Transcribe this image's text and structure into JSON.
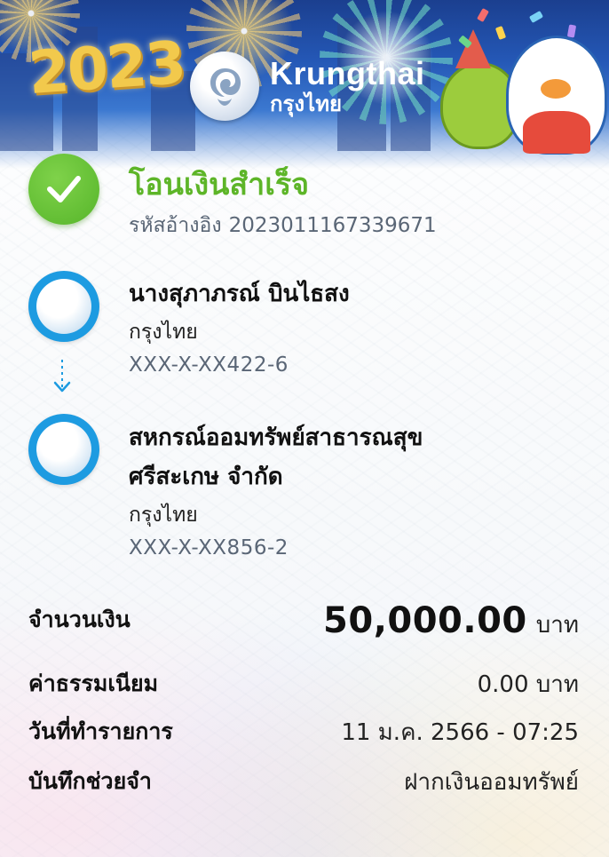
{
  "banner": {
    "year": "2023",
    "logo_en": "Krungthai",
    "logo_th": "กรุงไทย"
  },
  "status": {
    "title": "โอนเงินสำเร็จ",
    "ref_label": "รหัสอ้างอิง",
    "ref_value": "2023011167339671"
  },
  "sender": {
    "name": "นางสุภาภรณ์ บินไธสง",
    "bank": "กรุงไทย",
    "account": "XXX-X-XX422-6"
  },
  "receiver": {
    "name_line1": "สหกรณ์ออมทรัพย์สาธารณสุข",
    "name_line2": "ศรีสะเกษ จำกัด",
    "bank": "กรุงไทย",
    "account": "XXX-X-XX856-2"
  },
  "details": {
    "amount_label": "จำนวนเงิน",
    "amount_value": "50,000.00",
    "amount_unit": "บาท",
    "fee_label": "ค่าธรรมเนียม",
    "fee_value": "0.00 บาท",
    "date_label": "วันที่ทำรายการ",
    "date_value": "11 ม.ค. 2566 - 07:25",
    "memo_label": "บันทึกช่วยจำ",
    "memo_value": "ฝากเงินออมทรัพย์"
  },
  "icons": {
    "success": "check-circle-icon",
    "bank_logo": "krungthai-logo-icon",
    "transfer_direction": "arrow-down-icon"
  },
  "colors": {
    "success_green": "#5db528",
    "bank_blue": "#1d9be1",
    "secondary_text": "#5a6676"
  }
}
